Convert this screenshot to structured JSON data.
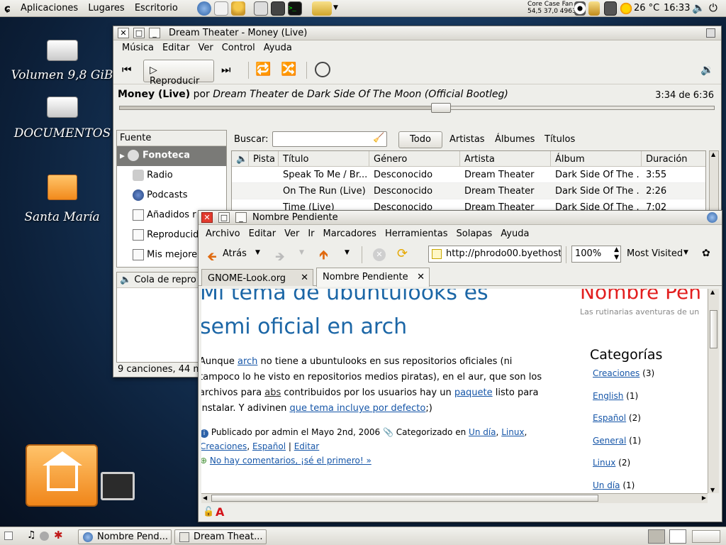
{
  "top_panel": {
    "menus": [
      "Aplicaciones",
      "Lugares",
      "Escritorio"
    ],
    "sensor_labels": "Core  Case  Fan",
    "sensor_values": "54,5  37,0  4963",
    "weather": "26 °C",
    "clock": "16:33"
  },
  "desktop_icons": [
    {
      "label": "Volumen 9,8 GiB"
    },
    {
      "label": "DOCUMENTOS"
    },
    {
      "label": "Santa María"
    }
  ],
  "rhythmbox": {
    "title": "Dream Theater - Money (Live)",
    "menu": [
      "Música",
      "Editar",
      "Ver",
      "Control",
      "Ayuda"
    ],
    "play_label": "Reproducir",
    "song_title": "Money (Live)",
    "by": "por",
    "artist": "Dream Theater",
    "de": "de",
    "album": "Dark Side Of The Moon (Official Bootleg)",
    "time": "3:34 de 6:36",
    "progress": 0.54,
    "source_header": "Fuente",
    "sources": [
      "Fonoteca",
      "Radio",
      "Podcasts",
      "Añadidos r",
      "Reproducid",
      "Mis mejore"
    ],
    "queue_label": "Cola de repro",
    "search_label": "Buscar:",
    "filter_all": "Todo",
    "filters": [
      "Artistas",
      "Álbumes",
      "Títulos"
    ],
    "columns": [
      "Pista",
      "Título",
      "Género",
      "Artista",
      "Álbum",
      "Duración"
    ],
    "rows": [
      {
        "title": "Speak To Me / Br...",
        "genre": "Desconocido",
        "artist": "Dream Theater",
        "album": "Dark Side Of The ...",
        "dur": "3:55"
      },
      {
        "title": "On The Run (Live)",
        "genre": "Desconocido",
        "artist": "Dream Theater",
        "album": "Dark Side Of The ...",
        "dur": "2:26"
      },
      {
        "title": "Time (Live)",
        "genre": "Desconocido",
        "artist": "Dream Theater",
        "album": "Dark Side Of The ...",
        "dur": "7:02"
      }
    ],
    "status": "9 canciones, 44 m"
  },
  "firefox": {
    "title": "Nombre Pendiente",
    "menu": [
      "Archivo",
      "Editar",
      "Ver",
      "Ir",
      "Marcadores",
      "Herramientas",
      "Solapas",
      "Ayuda"
    ],
    "back_label": "Atrás",
    "url": "http://phrodo00.byethost",
    "zoom": "100%",
    "most_visited": "Most Visited",
    "tabs": [
      "GNOME-Look.org",
      "Nombre Pendiente"
    ],
    "post_title_1": "Mi tema de ubuntulooks es",
    "post_title_2": "semi oficial en arch",
    "body_1a": "Aunque ",
    "body_link_arch": "arch",
    "body_1b": " no tiene a ubuntulooks en sus repositorios oficiales (ni",
    "body_2": "tampoco lo he visto en repositorios medios piratas), en el aur, que son los",
    "body_3a": "archivos para ",
    "body_link_abs": "abs",
    "body_3b": " contribuidos por los usuarios hay un ",
    "body_link_paquete": "paquete",
    "body_3c": " listo para",
    "body_4a": "instalar. Y adivinen ",
    "body_link_tema": "que tema incluye por defecto",
    "body_4b": ";)",
    "meta_1": "Publicado por admin el Mayo 2nd, 2006",
    "meta_cat": "Categorizado en",
    "meta_links": [
      "Un día",
      "Linux",
      "Creaciones",
      "Español"
    ],
    "meta_edit": "Editar",
    "comments": "No hay comentarios, ¡sé el primero! »",
    "blog_name": "Nombre Pen",
    "blog_tagline": "Las rutinarias aventuras de un",
    "cat_header": "Categorías",
    "categories": [
      {
        "name": "Creaciones",
        "count": "(3)"
      },
      {
        "name": "English",
        "count": "(1)"
      },
      {
        "name": "Español",
        "count": "(2)"
      },
      {
        "name": "General",
        "count": "(1)"
      },
      {
        "name": "Linux",
        "count": "(2)"
      },
      {
        "name": "Un día",
        "count": "(1)"
      }
    ]
  },
  "taskbar": [
    "Nombre Pend...",
    "Dream Theat..."
  ]
}
